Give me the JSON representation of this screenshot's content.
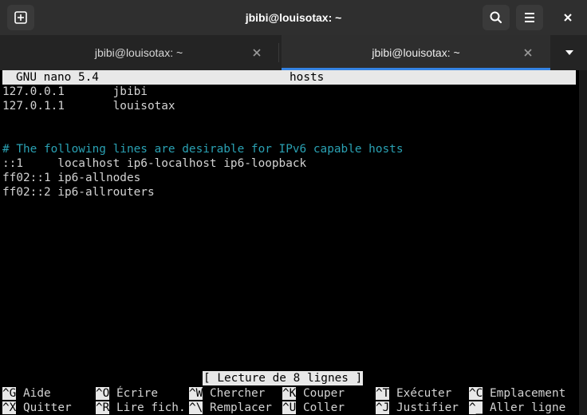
{
  "window": {
    "title": "jbibi@louisotax: ~"
  },
  "tabs": [
    {
      "label": "jbibi@louisotax: ~",
      "active": false
    },
    {
      "label": "jbibi@louisotax: ~",
      "active": true
    }
  ],
  "nano": {
    "version": "GNU nano 5.4",
    "filename": "hosts",
    "lines": [
      "127.0.0.1       jbibi",
      "127.0.1.1       louisotax",
      "",
      "",
      "# The following lines are desirable for IPv6 capable hosts",
      "::1     localhost ip6-localhost ip6-loopback",
      "ff02::1 ip6-allnodes",
      "ff02::2 ip6-allrouters"
    ],
    "status": "[ Lecture de 8 lignes ]",
    "shortcuts_row1": [
      {
        "key": "^G",
        "label": "Aide"
      },
      {
        "key": "^O",
        "label": "Écrire"
      },
      {
        "key": "^W",
        "label": "Chercher"
      },
      {
        "key": "^K",
        "label": "Couper"
      },
      {
        "key": "^T",
        "label": "Exécuter"
      },
      {
        "key": "^C",
        "label": "Emplacement"
      }
    ],
    "shortcuts_row2": [
      {
        "key": "^X",
        "label": "Quitter"
      },
      {
        "key": "^R",
        "label": "Lire fich."
      },
      {
        "key": "^\\",
        "label": "Remplacer"
      },
      {
        "key": "^U",
        "label": "Coller"
      },
      {
        "key": "^J",
        "label": "Justifier"
      },
      {
        "key": "^_",
        "label": "Aller ligne"
      }
    ]
  },
  "colors": {
    "terminal_bg": "#000000",
    "terminal_fg": "#d3d3d3",
    "comment": "#2aa1b3",
    "accent": "#3584e4"
  }
}
